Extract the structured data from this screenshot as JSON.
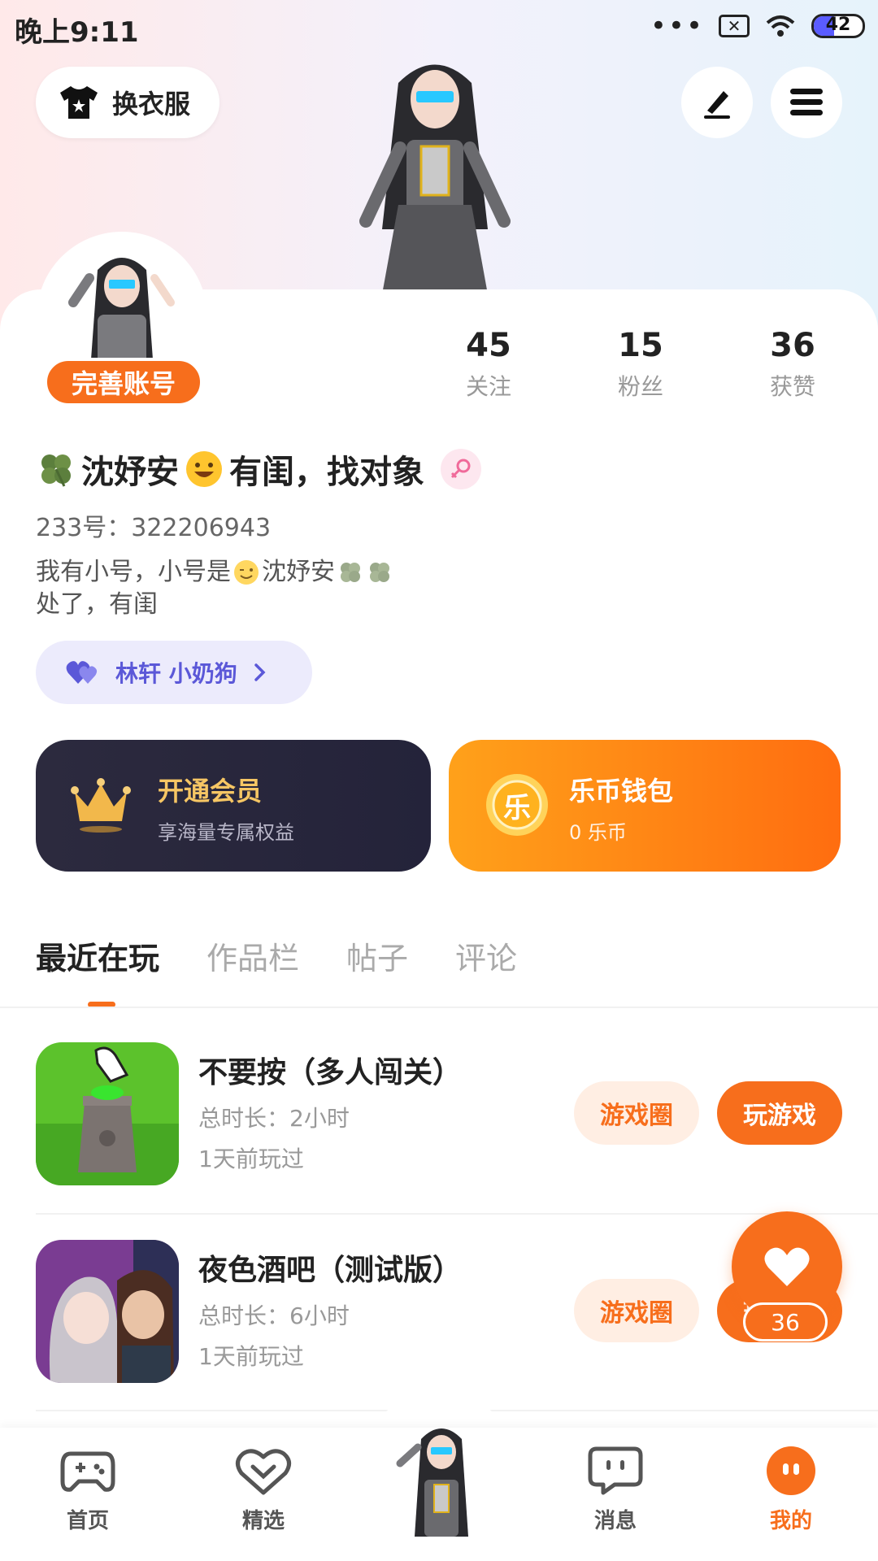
{
  "status_bar": {
    "time": "晚上9:11",
    "dots": "•••",
    "battery": "42",
    "battery_level": 0.42
  },
  "header": {
    "outfit_label": "换衣服"
  },
  "profile": {
    "complete_badge": "完善账号",
    "stats": [
      {
        "value": "45",
        "label": "关注"
      },
      {
        "value": "15",
        "label": "粉丝"
      },
      {
        "value": "36",
        "label": "获赞"
      }
    ],
    "name_part1": "沈妤安",
    "name_part2": "有闺，找对象",
    "uid": "233号：322206943",
    "bio_line1_part1": "我有小号，小号是",
    "bio_line1_part2": "沈妤安",
    "bio_line2": "处了，有闺",
    "couple_label": "林轩 小奶狗"
  },
  "promo": {
    "vip_title": "开通会员",
    "vip_sub": "享海量专属权益",
    "wallet_title": "乐币钱包",
    "wallet_sub": "0 乐币",
    "coin_char": "乐"
  },
  "tabs": [
    "最近在玩",
    "作品栏",
    "帖子",
    "评论"
  ],
  "games": [
    {
      "title": "不要按（多人闯关）",
      "duration": "总时长：2小时",
      "last_played": "1天前玩过",
      "circle_label": "游戏圈",
      "play_label": "玩游戏"
    },
    {
      "title": "夜色酒吧（测试版）",
      "duration": "总时长：6小时",
      "last_played": "1天前玩过",
      "circle_label": "游戏圈",
      "play_label": "玩游戏"
    }
  ],
  "like_count": "36",
  "bottom_nav": [
    {
      "label": "首页"
    },
    {
      "label": "精选"
    },
    {
      "label": "消息"
    },
    {
      "label": "我的"
    }
  ],
  "colors": {
    "accent": "#f76e1c",
    "purple": "#5b58d8",
    "dark_card": "#2c2a3e"
  }
}
